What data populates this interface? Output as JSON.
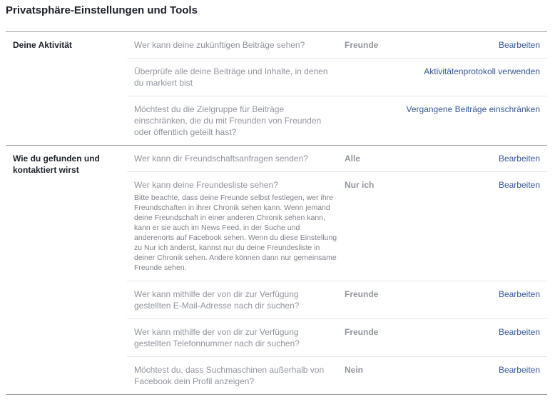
{
  "page_title": "Privatsphäre-Einstellungen und Tools",
  "sections": [
    {
      "heading": "Deine Aktivität",
      "rows": [
        {
          "question": "Wer kann deine zukünftigen Beiträge sehen?",
          "value": "Freunde",
          "action": "Bearbeiten"
        },
        {
          "question": "Überprüfe alle deine Beiträge und Inhalte, in denen du markiert bist",
          "value": "",
          "action": "Aktivitätenprotokoll verwenden"
        },
        {
          "question": "Möchtest du die Zielgruppe für Beiträge einschränken, die du mit Freunden von Freunden oder öffentlich geteilt hast?",
          "value": "",
          "action": "Vergangene Beiträge einschränken"
        }
      ]
    },
    {
      "heading": "Wie du gefunden und kontaktiert wirst",
      "rows": [
        {
          "question": "Wer kann dir Freundschaftsanfragen senden?",
          "value": "Alle",
          "action": "Bearbeiten"
        },
        {
          "question": "Wer kann deine Freundesliste sehen?",
          "note": "Bitte beachte, dass deine Freunde selbst festlegen, wer ihre Freundschaften in ihrer Chronik sehen kann. Wenn jemand deine Freundschaft in einer anderen Chronik sehen kann, kann er sie auch im News Feed, in der Suche und anderenorts auf Facebook sehen. Wenn du diese Einstellung zu Nur ich änderst, kannst nur du deine Freundesliste in deiner Chronik sehen. Andere können dann nur gemeinsame Freunde sehen.",
          "value": "Nur ich",
          "action": "Bearbeiten"
        },
        {
          "question": "Wer kann mithilfe der von dir zur Verfügung gestellten E-Mail-Adresse nach dir suchen?",
          "value": "Freunde",
          "action": "Bearbeiten"
        },
        {
          "question": "Wer kann mithilfe der von dir zur Verfügung gestellten Telefonnummer nach dir suchen?",
          "value": "Freunde",
          "action": "Bearbeiten"
        },
        {
          "question": "Möchtest du, dass Suchmaschinen außerhalb von Facebook dein Profil anzeigen?",
          "value": "Nein",
          "action": "Bearbeiten"
        }
      ]
    }
  ]
}
